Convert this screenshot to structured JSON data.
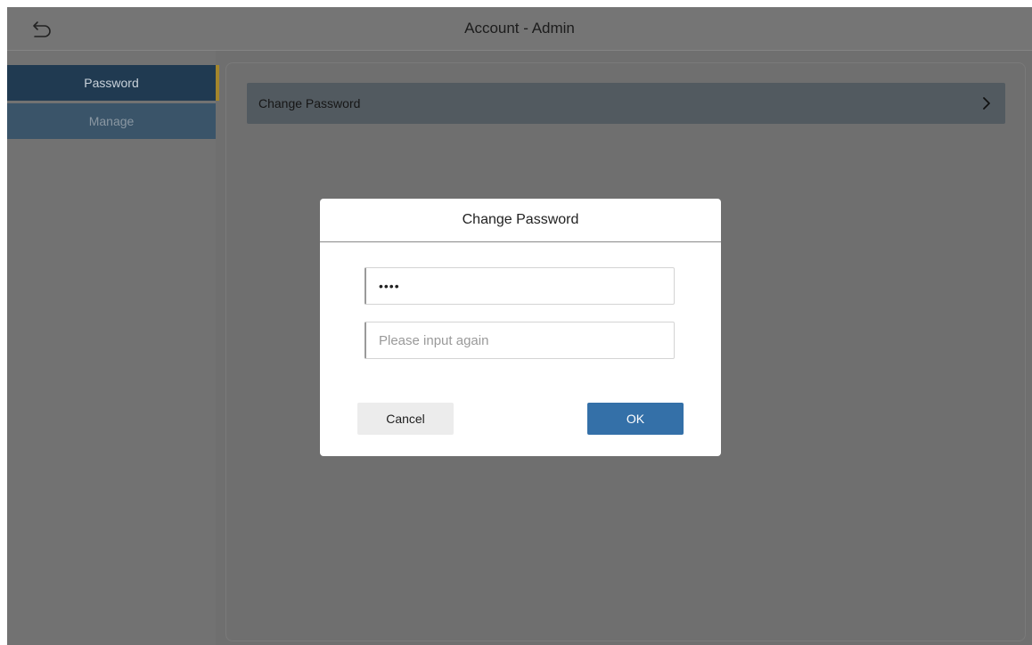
{
  "header": {
    "title": "Account - Admin",
    "back_icon": "back-arrow-icon"
  },
  "sidebar": {
    "items": [
      {
        "label": "Password",
        "active": true
      },
      {
        "label": "Manage",
        "active": false
      }
    ],
    "accent_color": "#a4862c",
    "active_bg": "#203a51"
  },
  "content": {
    "rows": [
      {
        "label": "Change Password",
        "icon": "chevron-right-icon"
      }
    ]
  },
  "dialog": {
    "title": "Change Password",
    "password_value": "••••",
    "confirm_placeholder": "Please input again",
    "cancel_label": "Cancel",
    "ok_label": "OK",
    "ok_color": "#3470a8"
  }
}
